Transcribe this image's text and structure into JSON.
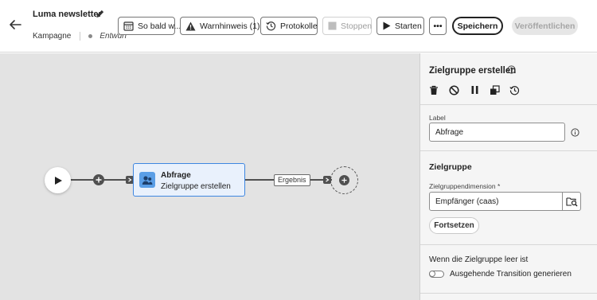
{
  "header": {
    "back_icon": "arrow-left-icon",
    "title": "Luma newsletter",
    "edit_icon": "pencil-icon",
    "type": "Kampagne",
    "status": "Entwurf",
    "status_dot_color": "#8a8a8a"
  },
  "toolbar": {
    "schedule_label": "So bald w...",
    "warning_label": "Warnhinweis (1)",
    "logs_label": "Protokolle",
    "stop_label": "Stoppen",
    "start_label": "Starten",
    "more_label": "•••",
    "save_label": "Speichern",
    "publish_label": "Veröffentlichen"
  },
  "canvas": {
    "activity": {
      "title": "Abfrage",
      "subtitle": "Zielgruppe erstellen",
      "icon": "audience-icon",
      "accent_color": "#3e86e0"
    },
    "transition_label": "Ergebnis"
  },
  "panel": {
    "title": "Zielgruppe erstellen",
    "tools": [
      "trash-icon",
      "disable-icon",
      "pause-icon",
      "copy-icon",
      "history-icon"
    ],
    "label_field": {
      "label": "Label",
      "value": "Abfrage"
    },
    "audience_section": {
      "heading": "Zielgruppe",
      "dimension_label": "Zielgruppendimension",
      "required_mark": "*",
      "dimension_value": "Empfänger (caas)",
      "continue_label": "Fortsetzen"
    },
    "empty_section": {
      "heading": "Wenn die Zielgruppe leer ist",
      "toggle_label": "Ausgehende Transition generieren",
      "toggle_on": false
    }
  }
}
